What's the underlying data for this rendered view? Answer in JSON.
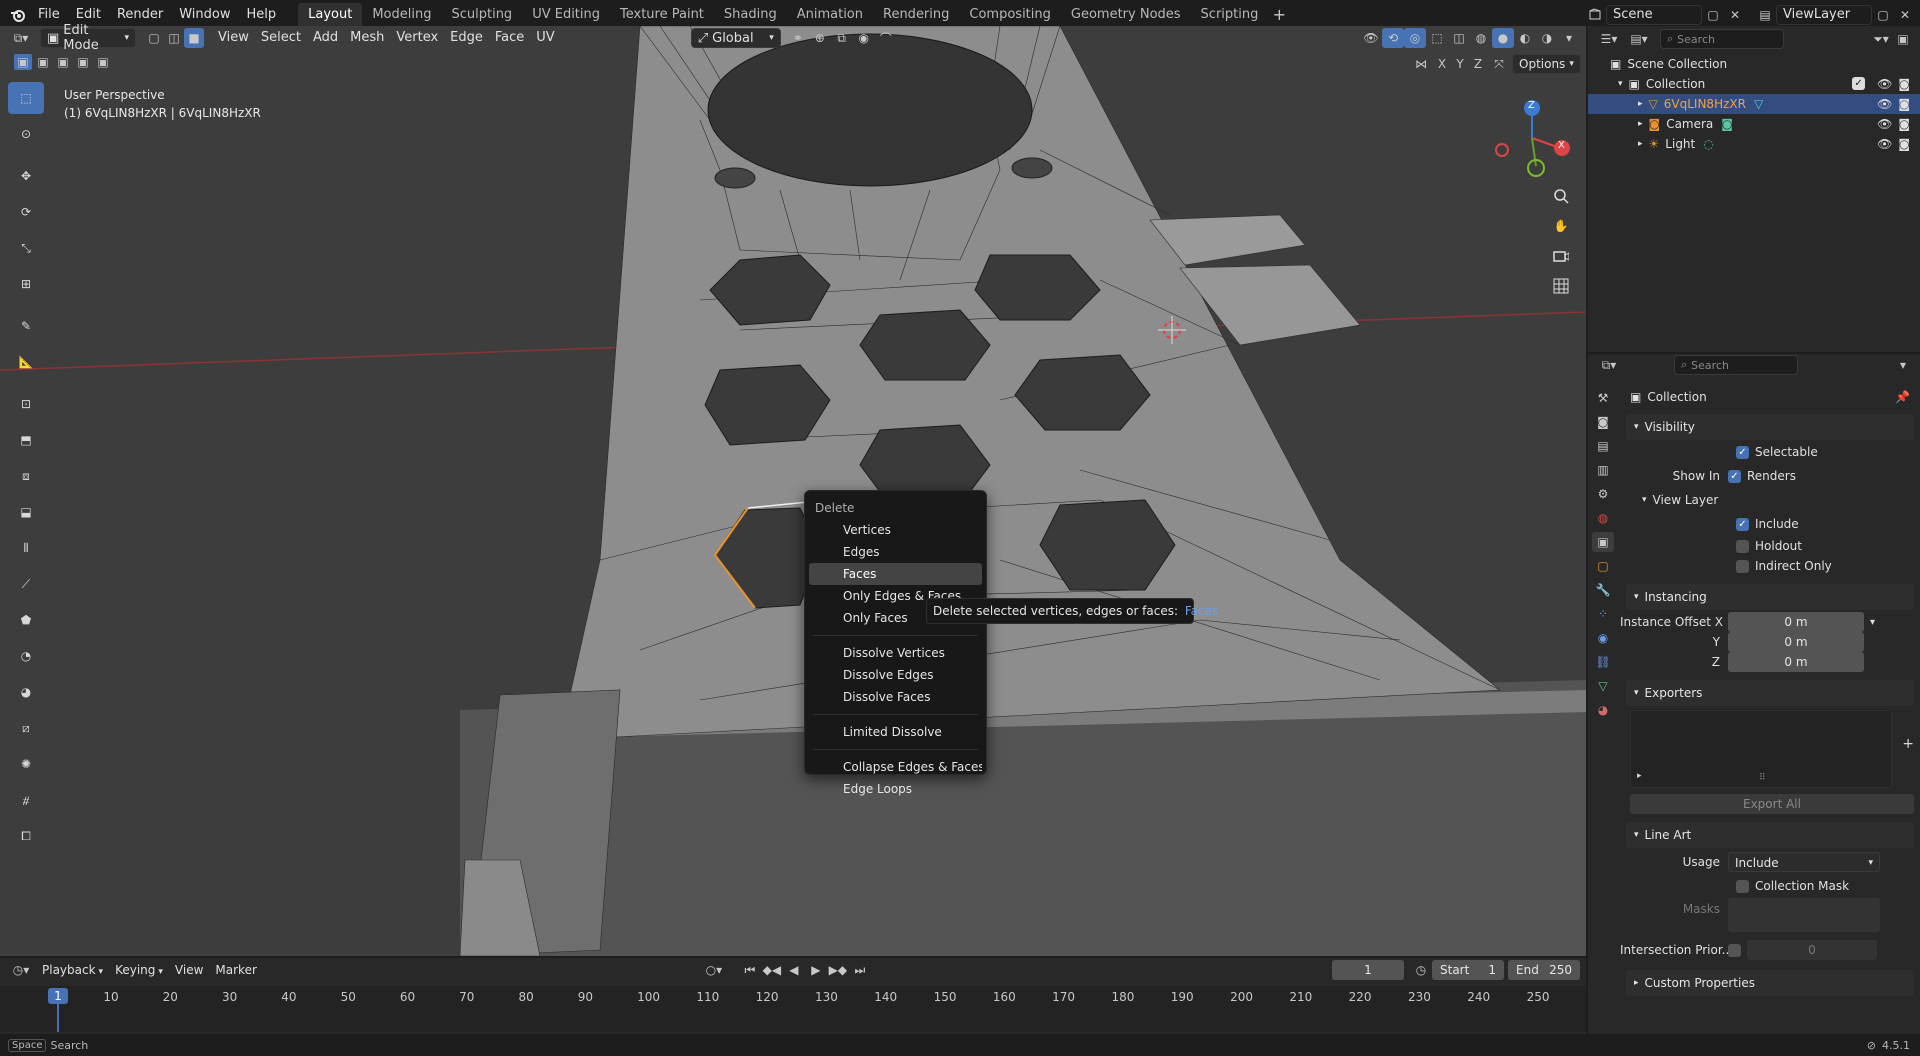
{
  "topbar": {
    "menus": [
      "File",
      "Edit",
      "Render",
      "Window",
      "Help"
    ],
    "workspaces": [
      "Layout",
      "Modeling",
      "Sculpting",
      "UV Editing",
      "Texture Paint",
      "Shading",
      "Animation",
      "Rendering",
      "Compositing",
      "Geometry Nodes",
      "Scripting"
    ],
    "active_workspace": "Layout",
    "scene": "Scene",
    "view_layer": "ViewLayer"
  },
  "viewport_header": {
    "mode": "Edit Mode",
    "menus": [
      "View",
      "Select",
      "Add",
      "Mesh",
      "Vertex",
      "Edge",
      "Face",
      "UV"
    ],
    "orientation": "Global",
    "options_label": "Options",
    "axes": [
      "X",
      "Y",
      "Z"
    ]
  },
  "viewport": {
    "perspective_label": "User Perspective",
    "object_label": "(1) 6VqLIN8HzXR | 6VqLIN8HzXR"
  },
  "context_menu": {
    "title": "Delete",
    "items": [
      "Vertices",
      "Edges",
      "Faces",
      "Only Edges & Faces",
      "Only Faces"
    ],
    "dissolve": [
      "Dissolve Vertices",
      "Dissolve Edges",
      "Dissolve Faces"
    ],
    "limited": "Limited Dissolve",
    "collapse": [
      "Collapse Edges & Faces",
      "Edge Loops"
    ],
    "highlighted": "Faces"
  },
  "tooltip": {
    "text": "Delete selected vertices, edges or faces:",
    "value": "Faces"
  },
  "outliner": {
    "search_placeholder": "Search",
    "scene_collection": "Scene Collection",
    "collection": "Collection",
    "objects": [
      "6VqLIN8HzXR",
      "Camera",
      "Light"
    ]
  },
  "properties": {
    "search_placeholder": "Search",
    "title": "Collection",
    "visibility": {
      "header": "Visibility",
      "selectable": "Selectable",
      "show_in": "Show In",
      "renders": "Renders",
      "view_layer": "View Layer",
      "include": "Include",
      "holdout": "Holdout",
      "indirect_only": "Indirect Only"
    },
    "instancing": {
      "header": "Instancing",
      "offset_x_label": "Instance Offset X",
      "y_label": "Y",
      "z_label": "Z",
      "x": "0 m",
      "y": "0 m",
      "z": "0 m"
    },
    "exporters": {
      "header": "Exporters",
      "export_all": "Export All"
    },
    "line_art": {
      "header": "Line Art",
      "usage_label": "Usage",
      "usage_value": "Include",
      "collection_mask": "Collection Mask",
      "masks_label": "Masks",
      "intersection_label": "Intersection Prior...",
      "intersection_value": "0"
    },
    "custom_properties": "Custom Properties"
  },
  "timeline": {
    "menus": [
      "Playback",
      "Keying",
      "View",
      "Marker"
    ],
    "current_frame": "1",
    "start_label": "Start",
    "start": "1",
    "end_label": "End",
    "end": "250",
    "ruler": [
      "1",
      "10",
      "20",
      "30",
      "40",
      "50",
      "60",
      "70",
      "80",
      "90",
      "100",
      "110",
      "120",
      "130",
      "140",
      "150",
      "160",
      "170",
      "180",
      "190",
      "200",
      "210",
      "220",
      "230",
      "240",
      "250"
    ]
  },
  "statusbar": {
    "key": "Space",
    "action": "Search",
    "version": "4.5.1"
  },
  "colors": {
    "accent": "#4772b3",
    "selection": "#e8922e",
    "background": "#1d1d1d",
    "viewport": "#3d3d3d"
  }
}
